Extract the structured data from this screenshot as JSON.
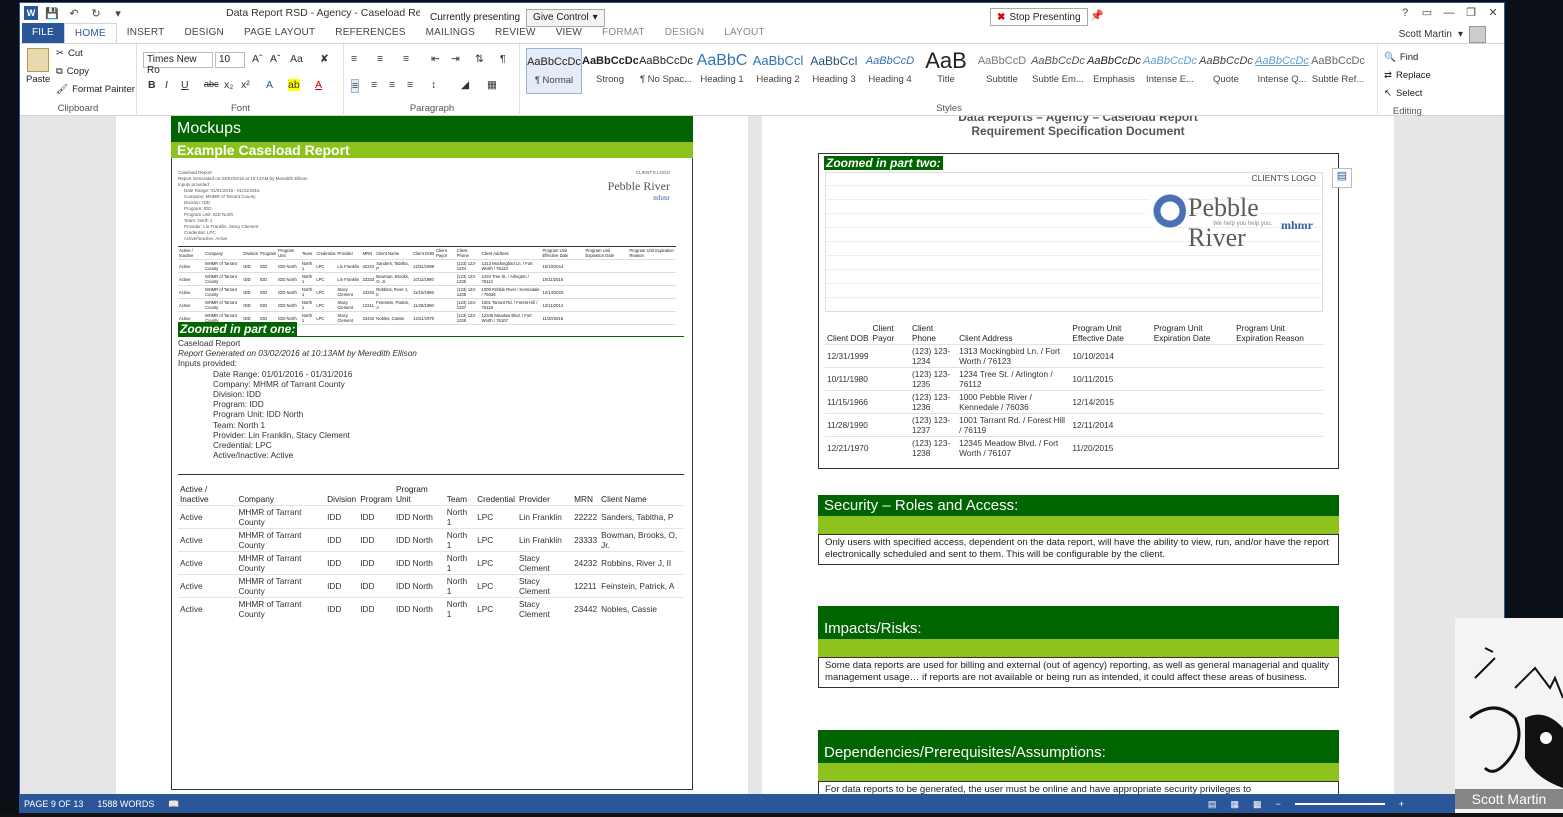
{
  "window": {
    "title": "Data Report RSD - Agency - Caseload Report - Word",
    "presenting_label": "Currently presenting",
    "give_control": "Give Control",
    "stop_presenting": "Stop Presenting",
    "controls": [
      "?",
      "▭",
      "—",
      "❐",
      "✕"
    ]
  },
  "tabs": [
    "FILE",
    "HOME",
    "INSERT",
    "DESIGN",
    "PAGE LAYOUT",
    "REFERENCES",
    "MAILINGS",
    "REVIEW",
    "VIEW",
    "FORMAT",
    "DESIGN",
    "LAYOUT"
  ],
  "user": {
    "name": "Scott Martin"
  },
  "ribbon": {
    "clipboard": {
      "paste": "Paste",
      "cut": "Cut",
      "copy": "Copy",
      "format_painter": "Format Painter",
      "label": "Clipboard"
    },
    "font": {
      "name": "Times New Ro",
      "size": "10",
      "label": "Font"
    },
    "paragraph": {
      "label": "Paragraph"
    },
    "styles": {
      "label": "Styles",
      "items": [
        {
          "preview": "AaBbCcDc",
          "name": "¶ Normal"
        },
        {
          "preview": "AaBbCcDc",
          "name": "Strong"
        },
        {
          "preview": "AaBbCcDc",
          "name": "¶ No Spac..."
        },
        {
          "preview": "AaBbC",
          "name": "Heading 1"
        },
        {
          "preview": "AaBbCcl",
          "name": "Heading 2"
        },
        {
          "preview": "AaBbCcI",
          "name": "Heading 3"
        },
        {
          "preview": "AaBbCcD",
          "name": "Heading 4"
        },
        {
          "preview": "AaB",
          "name": "Title"
        },
        {
          "preview": "AaBbCcD",
          "name": "Subtitle"
        },
        {
          "preview": "AaBbCcDc",
          "name": "Subtle Em..."
        },
        {
          "preview": "AaBbCcDc",
          "name": "Emphasis"
        },
        {
          "preview": "AaBbCcDc",
          "name": "Intense E..."
        },
        {
          "preview": "AaBbCcDc",
          "name": "Quote"
        },
        {
          "preview": "AaBbCcDc",
          "name": "Intense Q..."
        },
        {
          "preview": "AaBbCcDc",
          "name": "Subtle Ref..."
        }
      ]
    },
    "editing": {
      "find": "Find",
      "replace": "Replace",
      "select": "Select",
      "label": "Editing"
    }
  },
  "left_page": {
    "mockups": "Mockups",
    "example": "Example Caseload Report",
    "thumb": {
      "title": "Caseload Report",
      "client_logo": "CLIENT'S LOGO",
      "logo_text": "Pebble River",
      "logo_sub": "mhmr"
    },
    "zoom_one": "Zoomed in part one:",
    "report": {
      "title": "Caseload Report",
      "generated": "Report Generated on 03/02/2016 at 10:13AM by Meredith Ellison",
      "inputs": "Inputs provided:",
      "params": [
        "Date Range:  01/01/2016 - 01/31/2016",
        "Company:  MHMR of Tarrant County",
        "Division:  IDD",
        "Program:  IDD",
        "Program Unit:  IDD North",
        "Team:  North 1",
        "Provider:  Lin Franklin, Stacy Clement",
        "Credential:  LPC",
        "Active/Inactive:  Active"
      ]
    },
    "table": {
      "headers": [
        "Active / Inactive",
        "Company",
        "Division",
        "Program",
        "Program Unit",
        "Team",
        "Credential",
        "Provider",
        "MRN",
        "Client Name"
      ],
      "rows": [
        [
          "Active",
          "MHMR of Tarrant County",
          "IDD",
          "IDD",
          "IDD North",
          "North 1",
          "LPC",
          "Lin Franklin",
          "22222",
          "Sanders, Tabitha, P"
        ],
        [
          "Active",
          "MHMR of Tarrant County",
          "IDD",
          "IDD",
          "IDD North",
          "North 1",
          "LPC",
          "Lin Franklin",
          "23333",
          "Bowman, Brooks, O, Jr."
        ],
        [
          "Active",
          "MHMR of Tarrant County",
          "IDD",
          "IDD",
          "IDD North",
          "North 1",
          "LPC",
          "Stacy Clement",
          "24232",
          "Robbins, River J, II"
        ],
        [
          "Active",
          "MHMR of Tarrant County",
          "IDD",
          "IDD",
          "IDD North",
          "North 1",
          "LPC",
          "Stacy Clement",
          "12211",
          "Feinstein, Patrick, A"
        ],
        [
          "Active",
          "MHMR of Tarrant County",
          "IDD",
          "IDD",
          "IDD North",
          "North 1",
          "LPC",
          "Stacy Clement",
          "23442",
          "Nobles, Cassie"
        ]
      ]
    }
  },
  "right_page": {
    "header1": "Data Reports – Agency – Caseload Report",
    "header2": "Requirement Specification Document",
    "zoom_two": "Zoomed in part two:",
    "client_logo": "CLIENT'S LOGO",
    "logo_text": "Pebble River",
    "logo_tag": "We help you help you.",
    "logo_sub": "mhmr",
    "table": {
      "headers": [
        "Client DOB",
        "Client Payor",
        "Client Phone",
        "Client Address",
        "Program Unit Effective Date",
        "Program Unit Expiration Date",
        "Program Unit Expiration Reason"
      ],
      "rows": [
        [
          "12/31/1999",
          "",
          "(123) 123-1234",
          "1313 Mockingbird Ln. / Fort Worth / 76123",
          "10/10/2014",
          "",
          ""
        ],
        [
          "10/11/1980",
          "",
          "(123) 123-1235",
          "1234 Tree St. / Arlington / 76112",
          "10/11/2015",
          "",
          ""
        ],
        [
          "11/15/1966",
          "",
          "(123) 123-1236",
          "1000 Pebble River / Kennedale / 76036",
          "12/14/2015",
          "",
          ""
        ],
        [
          "11/28/1990",
          "",
          "(123) 123-1237",
          "1001 Tarrant Rd. / Forest Hill / 76119",
          "12/11/2014",
          "",
          ""
        ],
        [
          "12/21/1970",
          "",
          "(123) 123-1238",
          "12345 Meadow Blvd. / Fort Worth / 76107",
          "11/20/2015",
          "",
          ""
        ]
      ]
    },
    "security": {
      "title": "Security – Roles and Access:",
      "text": "Only users with specified access, dependent on the data report, will have the ability to view, run, and/or have the report electronically scheduled and sent to them.  This will be configurable by the client."
    },
    "impacts": {
      "title": "Impacts/Risks:",
      "text": "Some data reports are used for billing and external (out of agency) reporting, as well as general managerial and quality management usage… if reports are not available or being run as intended, it could affect these areas of business."
    },
    "deps": {
      "title": "Dependencies/Prerequisites/Assumptions:",
      "text": "For data reports to be generated, the user must be online and have appropriate security privileges to"
    }
  },
  "status": {
    "page": "PAGE 9 OF 13",
    "words": "1588 WORDS"
  },
  "webcam": {
    "name": "Scott Martin"
  },
  "colors": {
    "green": "#006400",
    "lime": "#8dc11c",
    "word_blue": "#2b579a"
  }
}
